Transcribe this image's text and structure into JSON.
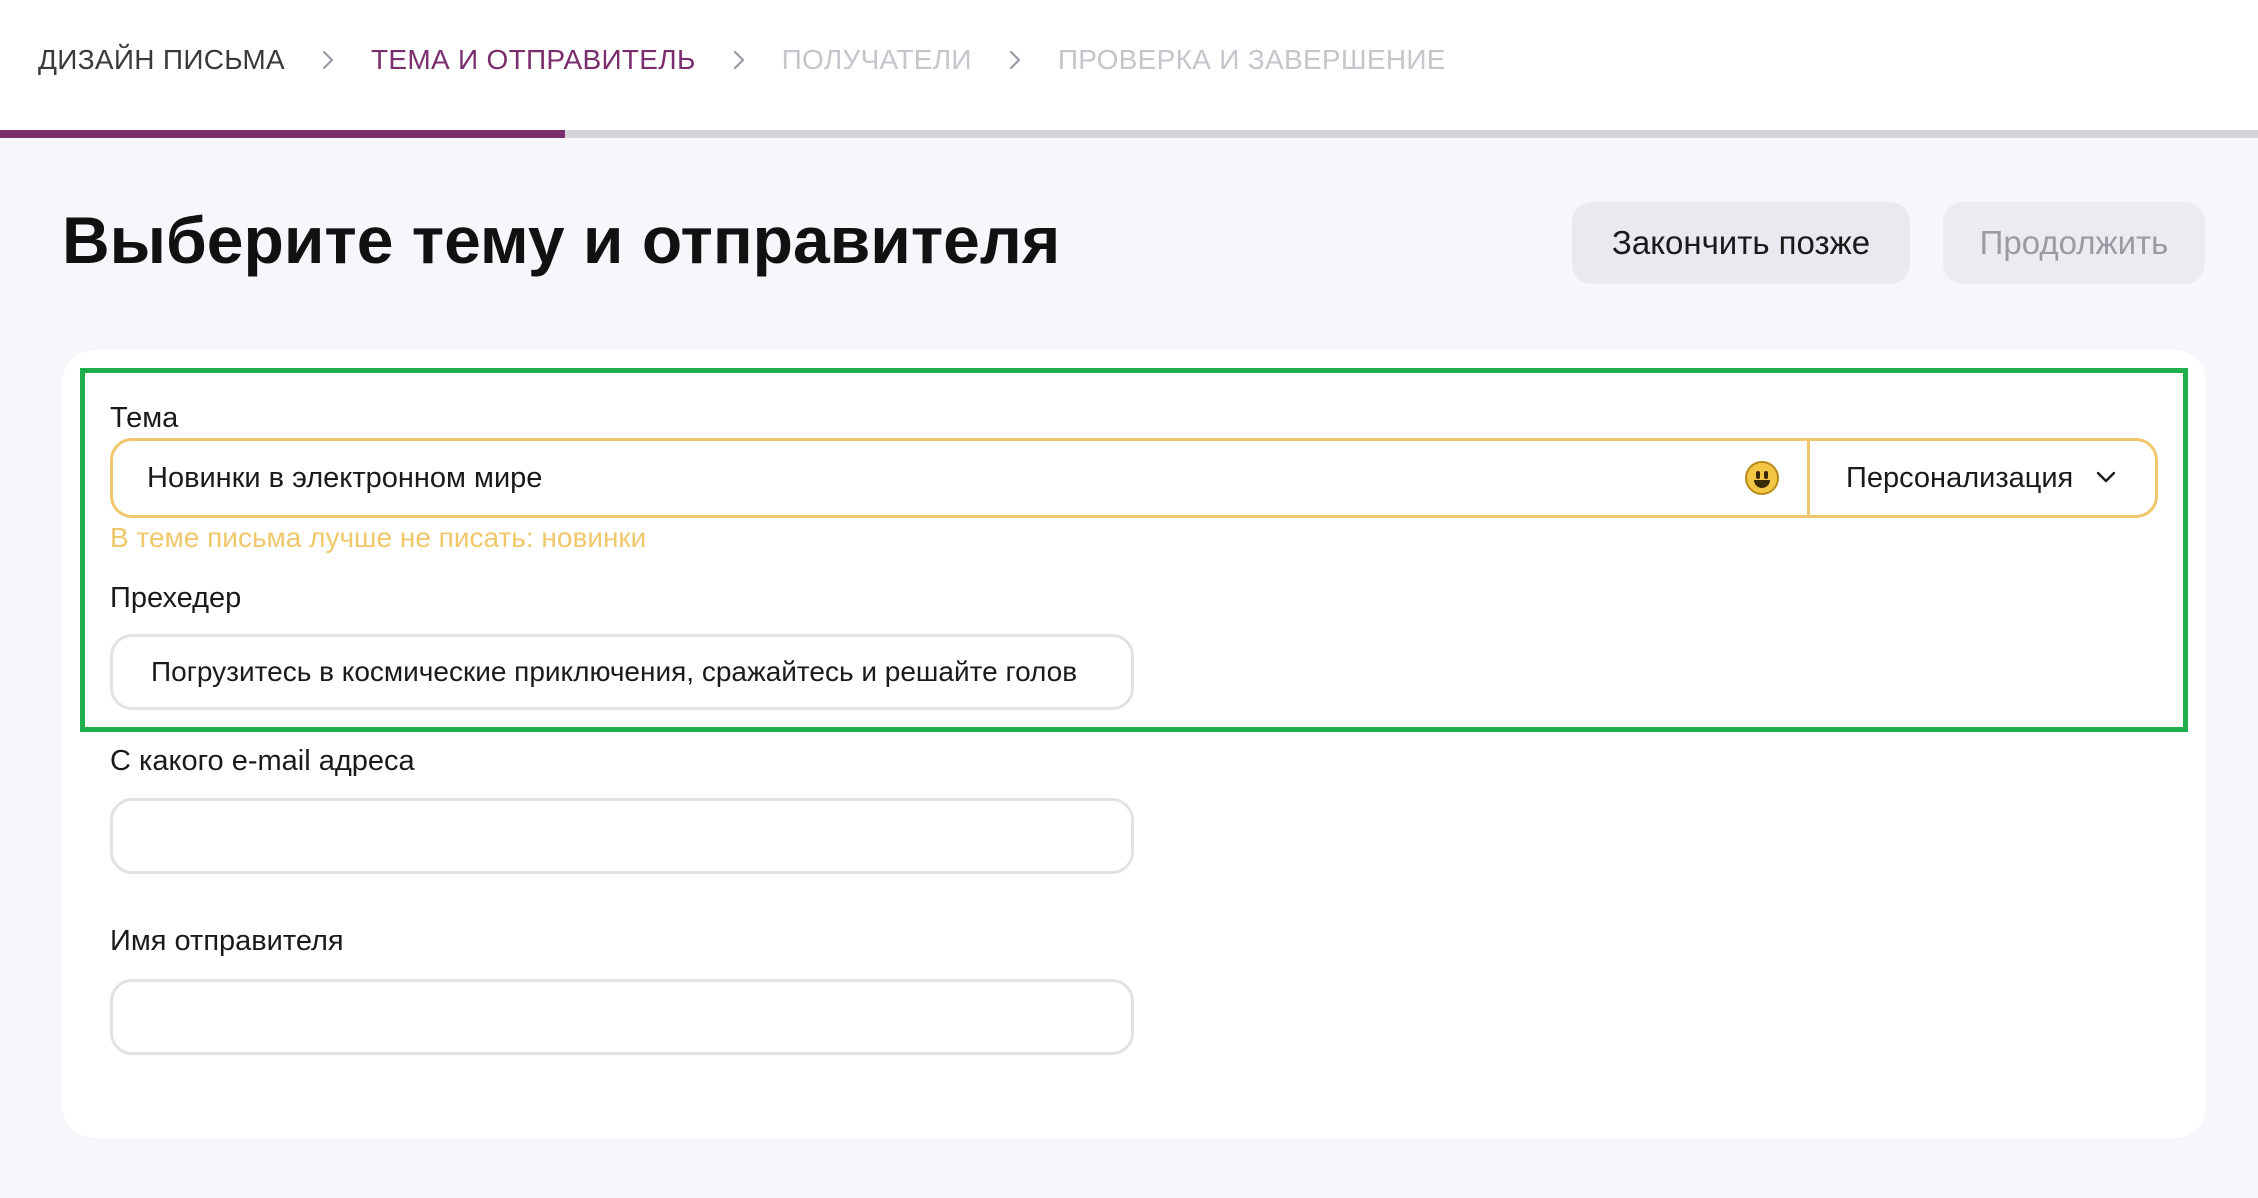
{
  "breadcrumbs": [
    {
      "label": "ДИЗАЙН ПИСЬМА",
      "state": "done"
    },
    {
      "label": "ТЕМА И ОТПРАВИТЕЛЬ",
      "state": "active"
    },
    {
      "label": "ПОЛУЧАТЕЛИ",
      "state": "todo"
    },
    {
      "label": "ПРОВЕРКА И ЗАВЕРШЕНИЕ",
      "state": "todo"
    }
  ],
  "progress": {
    "value_percent": 25,
    "color": "#7a2e6e"
  },
  "page_title": "Выберите тему и отправителя",
  "buttons": {
    "finish_later": "Закончить позже",
    "continue": "Продолжить"
  },
  "form": {
    "subject": {
      "label": "Тема",
      "value": "Новинки в электронном мире",
      "emoji_icon": "smiley-icon",
      "personalization_label": "Персонализация",
      "warning": "В теме письма лучше не писать: новинки",
      "warning_color": "#f0c76b"
    },
    "preheader": {
      "label": "Прехедер",
      "value": "Погрузитесь в космические приключения, сражайтесь и решайте голов"
    },
    "from_email": {
      "label": "С какого e-mail адреса",
      "value": ""
    },
    "sender_name": {
      "label": "Имя отправителя",
      "value": ""
    }
  },
  "colors": {
    "accent": "#7a2e6e",
    "highlight_border": "#1fae4b",
    "warning": "#f0c76b"
  }
}
